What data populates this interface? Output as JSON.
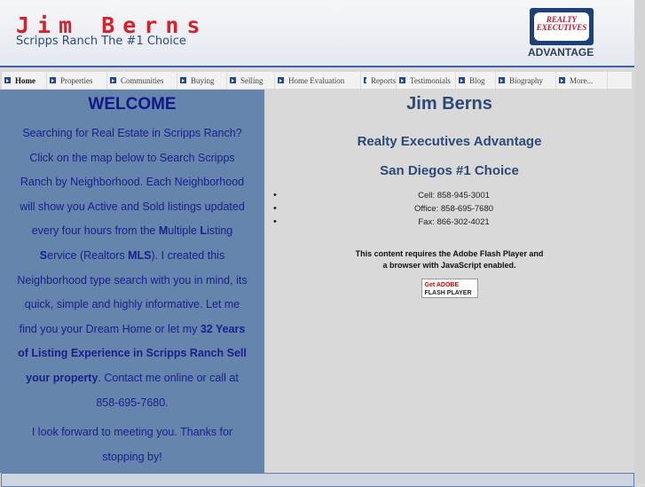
{
  "header": {
    "name": "Jim Berns",
    "tagline": "Scripps Ranch The #1 Choice",
    "logo_text": "REALTY EXECUTIVES",
    "logo_sub": "ADVANTAGE"
  },
  "nav": [
    {
      "label": "Home",
      "active": true
    },
    {
      "label": "Properties"
    },
    {
      "label": "Communities"
    },
    {
      "label": "Buying"
    },
    {
      "label": "Selling"
    },
    {
      "label": "Home Evaluation"
    },
    {
      "label": "Reports"
    },
    {
      "label": "Testimonials"
    },
    {
      "label": "Blog"
    },
    {
      "label": "Biography"
    },
    {
      "label": "More..."
    }
  ],
  "welcome": {
    "title": "WELCOME",
    "p1": [
      {
        "t": "Searching for Real Estate in Scripps Ranch? Click on the map below to Search Scripps Ranch by Neighborhood. Each Neighborhood will show you Active and Sold listings updated every four hours from the "
      },
      {
        "t": "M",
        "b": true
      },
      {
        "t": "ultiple "
      },
      {
        "t": "L",
        "b": true
      },
      {
        "t": "isting "
      },
      {
        "t": "S",
        "b": true
      },
      {
        "t": "ervice (Realtors "
      },
      {
        "t": "MLS",
        "b": true
      },
      {
        "t": ").  I created this Neighborhood type search with you in mind, its quick, simple and highly informative. Let me find you your Dream Home or let my "
      },
      {
        "t": "32 Years of Listing Experience in Scripps Ranch Sell your property",
        "b": true
      },
      {
        "t": ". Contact me online or call at 858-695-7680."
      }
    ],
    "p2": "I look forward to meeting you. Thanks for stopping by!"
  },
  "main": {
    "title": "Jim Berns",
    "subtitle": "Realty Executives Advantage",
    "subtitle2": "San Diegos #1 Choice",
    "contacts": [
      "Cell: 858-945-3001",
      "Office: 858-695-7680",
      "Fax: 866-302-4021"
    ],
    "flash_line1": "This content requires the Adobe Flash Player and",
    "flash_line2": "a browser with JavaScript enabled.",
    "flash_btn_top": "Get ADOBE",
    "flash_btn_bottom": "FLASH PLAYER"
  }
}
